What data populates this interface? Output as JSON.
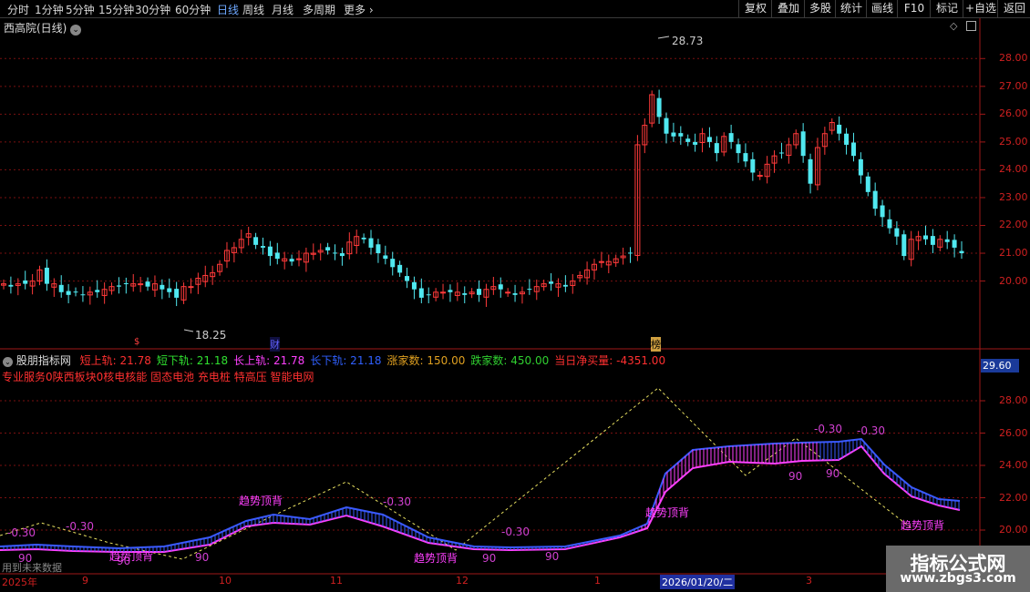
{
  "toolbar": {
    "timeframes": [
      "分时",
      "1分钟",
      "5分钟",
      "15分钟",
      "30分钟",
      "60分钟",
      "日线",
      "周线",
      "月线",
      "多周期",
      "更多"
    ],
    "active_timeframe": "日线",
    "buttons": [
      "复权",
      "叠加",
      "多股",
      "统计",
      "画线",
      "F10",
      "标记",
      "+自选",
      "返回"
    ]
  },
  "main_panel": {
    "title": "西高院(日线)",
    "high_label": "28.73",
    "low_label": "18.25",
    "markers": [
      "$",
      "财",
      "榜"
    ],
    "y_ticks": [
      "28.00",
      "27.00",
      "26.00",
      "25.00",
      "24.00",
      "23.00",
      "22.00",
      "21.00",
      "20.00"
    ]
  },
  "indicator_panel": {
    "name": "股朋指标网",
    "legend": [
      {
        "label": "短上轨: 21.78",
        "color": "#ff3030"
      },
      {
        "label": "短下轨: 21.18",
        "color": "#30e030"
      },
      {
        "label": "长上轨: 21.78",
        "color": "#ff40ff"
      },
      {
        "label": "长下轨: 21.18",
        "color": "#3060ff"
      },
      {
        "label": "涨家数: 150.00",
        "color": "#e0a020"
      },
      {
        "label": "跌家数: 450.00",
        "color": "#30d030"
      },
      {
        "label": "当日净买量: -4351.00",
        "color": "#ff3030"
      }
    ],
    "subtitle": "专业服务0陕西板块0核电核能 固态电池 充电桩 特高压 智能电网",
    "value_box": "29.60",
    "y_ticks": [
      "28.00",
      "26.00",
      "24.00",
      "22.00",
      "20.00"
    ],
    "annotations": {
      "minus_030": "-0.30",
      "ninety": "90",
      "divergence": "趋势顶背"
    }
  },
  "date_axis": {
    "labels": [
      "2025年",
      "9",
      "10",
      "11",
      "12",
      "1",
      "2026/01/20/二",
      "3"
    ],
    "note": "用到未来数据"
  },
  "watermark": {
    "line1": "指标公式网",
    "line2": "www.zbgs3.com"
  },
  "chart_data": {
    "type": "candlestick",
    "price_range": [
      18.25,
      28.73
    ],
    "closes": [
      19.9,
      19.8,
      19.9,
      19.9,
      20.0,
      20.4,
      19.9,
      19.9,
      19.6,
      19.5,
      19.6,
      19.5,
      19.6,
      19.6,
      19.7,
      19.8,
      19.8,
      19.9,
      19.9,
      19.9,
      19.8,
      19.9,
      19.7,
      19.6,
      19.4,
      19.8,
      19.8,
      20.1,
      20.2,
      20.3,
      20.6,
      21.1,
      21.2,
      21.5,
      21.7,
      21.3,
      21.2,
      20.9,
      20.8,
      20.8,
      20.7,
      20.8,
      21.0,
      21.0,
      21.1,
      21.1,
      21.0,
      20.9,
      21.4,
      21.6,
      21.5,
      21.2,
      21.0,
      20.8,
      20.5,
      20.3,
      20.0,
      19.7,
      19.4,
      19.5,
      19.6,
      19.6,
      19.6,
      19.6,
      19.5,
      19.6,
      19.5,
      19.7,
      19.8,
      19.7,
      19.6,
      19.5,
      19.6,
      19.7,
      19.8,
      19.9,
      19.9,
      19.9,
      19.8,
      20.0,
      20.2,
      20.4,
      20.6,
      20.7,
      20.7,
      20.8,
      20.9,
      21.0,
      24.9,
      25.6,
      26.7,
      25.9,
      25.3,
      25.2,
      25.2,
      25.0,
      24.9,
      25.3,
      25.0,
      24.6,
      25.2,
      25.0,
      24.6,
      24.3,
      23.9,
      23.8,
      24.2,
      24.5,
      24.6,
      24.9,
      25.3,
      24.5,
      23.5,
      24.8,
      25.3,
      25.7,
      25.3,
      24.9,
      24.5,
      23.8,
      23.2,
      22.6,
      22.3,
      21.9,
      21.6,
      20.9,
      21.5,
      21.6,
      21.5,
      21.3,
      21.5,
      21.4,
      21.2,
      21.0
    ]
  }
}
